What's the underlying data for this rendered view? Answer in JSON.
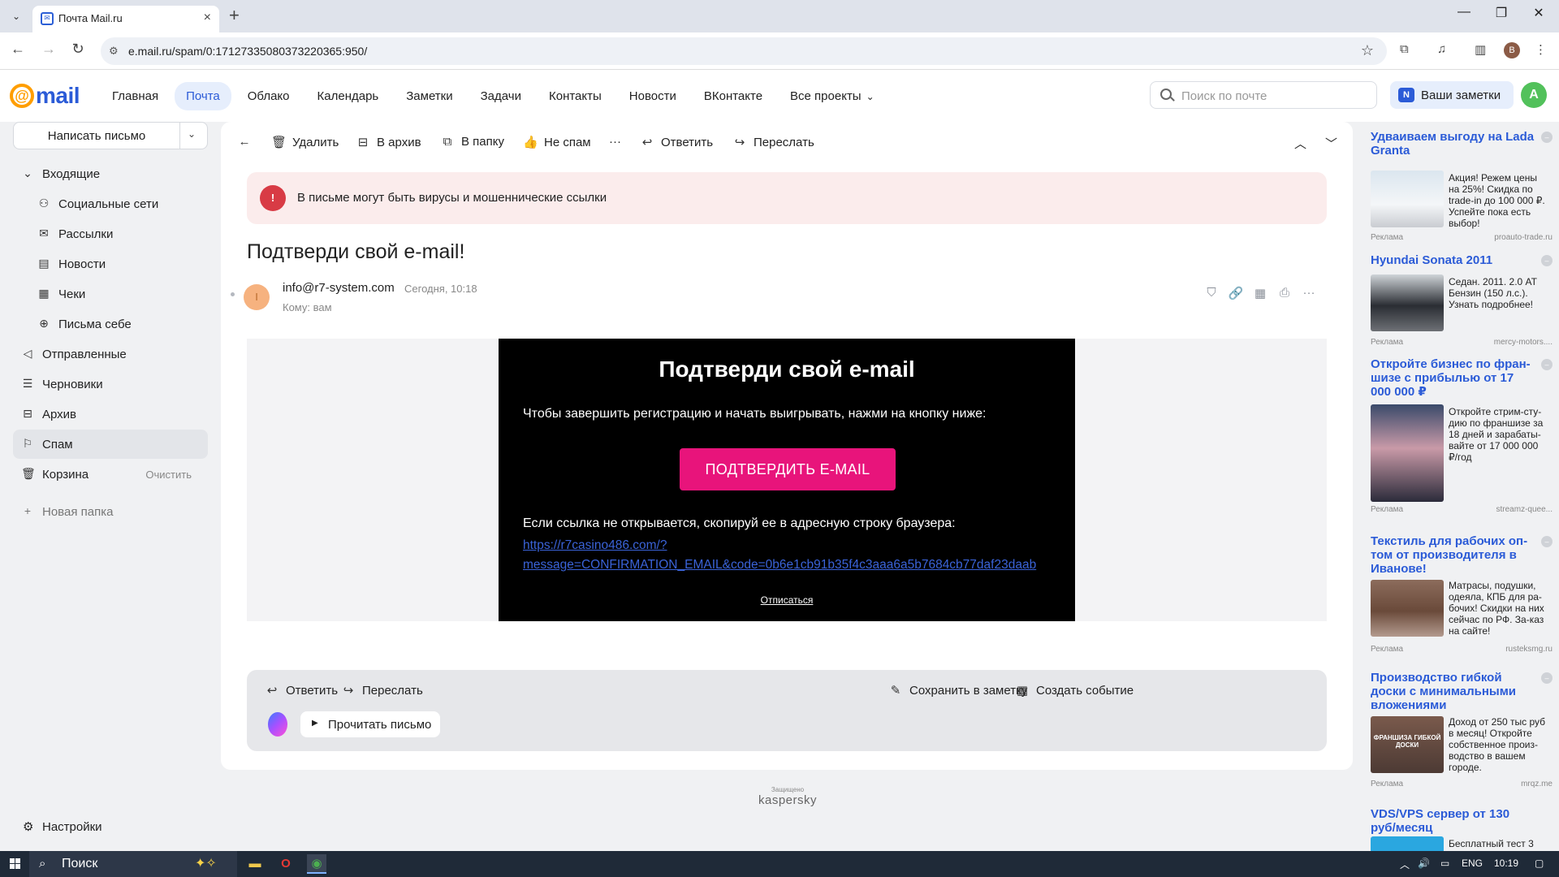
{
  "browser": {
    "tab_title": "Почта Mail.ru",
    "url": "e.mail.ru/spam/0:17127335080373220365:950/",
    "profile_initial": "B"
  },
  "header": {
    "logo_text": "mail",
    "nav": [
      "Главная",
      "Почта",
      "Облако",
      "Календарь",
      "Заметки",
      "Задачи",
      "Контакты",
      "Новости",
      "ВКонтакте",
      "Все проекты"
    ],
    "active_nav": "Почта",
    "search_placeholder": "Поиск по почте",
    "notes_label": "Ваши заметки",
    "avatar_initial": "A"
  },
  "sidebar": {
    "compose_label": "Написать письмо",
    "folders": [
      {
        "label": "Входящие",
        "icon": "chevron-down-icon"
      },
      {
        "label": "Социальные сети",
        "icon": "people-icon"
      },
      {
        "label": "Рассылки",
        "icon": "newsletter-icon"
      },
      {
        "label": "Новости",
        "icon": "news-icon"
      },
      {
        "label": "Чеки",
        "icon": "receipt-icon"
      },
      {
        "label": "Письма себе",
        "icon": "self-mail-icon"
      },
      {
        "label": "Отправленные",
        "icon": "sent-icon"
      },
      {
        "label": "Черновики",
        "icon": "draft-icon"
      },
      {
        "label": "Архив",
        "icon": "archive-icon"
      },
      {
        "label": "Спам",
        "icon": "spam-icon"
      },
      {
        "label": "Корзина",
        "icon": "trash-icon",
        "extra": "Очистить"
      }
    ],
    "new_folder": "Новая папка",
    "settings": "Настройки",
    "active_folder": "Спам"
  },
  "toolbar": {
    "delete": "Удалить",
    "archive": "В архив",
    "move": "В папку",
    "not_spam": "Не спам",
    "more": "···",
    "reply": "Ответить",
    "forward": "Переслать"
  },
  "warning": {
    "text": "В письме могут быть вирусы и мошеннические ссылки"
  },
  "message": {
    "subject": "Подтверди свой e-mail!",
    "sender_initial": "I",
    "from": "info@r7-system.com",
    "time": "Сегодня, 10:18",
    "to": "Кому: вам"
  },
  "email": {
    "title": "Подтверди свой e-mail",
    "intro": "Чтобы завершить регистрацию и начать выигрывать, нажми на кнопку ниже:",
    "button": "ПОДТВЕРДИТЬ E-MAIL",
    "copy_hint": "Если ссылка не открывается, скопируй ее в адресную строку браузера:",
    "link_line1": "https://r7casino486.com/?",
    "link_line2": "message=CONFIRMATION_EMAIL&code=0b6e1cb91b35f4c3aaa6a5b7684cb77daf23daab",
    "unsubscribe": "Отписаться",
    "accent_color": "#e8147b"
  },
  "reply_box": {
    "reply": "Ответить",
    "forward": "Переслать",
    "save_note": "Сохранить в заметку",
    "create_event": "Создать событие",
    "read_letter": "Прочитать письмо"
  },
  "footer": {
    "protected": "Защищено",
    "brand": "kaspersky"
  },
  "ads": [
    {
      "title": "Удваиваем выгоду на Lada Granta",
      "text": "Акция! Режем цены на 25%! Скидка по trade-in до 100 000 ₽. Успейте пока есть выбор!",
      "label": "Реклама",
      "domain": "proauto-trade.ru"
    },
    {
      "title": "Hyundai Sonata 2011",
      "text": "Седан. 2011. 2.0 AT Бензин (150 л.с.). Узнать подробнее!",
      "label": "Реклама",
      "domain": "mercy-motors...."
    },
    {
      "title": "Откройте бизнес по фран-шизе с прибылью от 17 000 000 ₽",
      "text": "Откройте стрим-сту-дию по франшизе за 18 дней и зарабаты-вайте от 17 000 000 ₽/год",
      "label": "Реклама",
      "domain": "streamz-quee..."
    },
    {
      "title": "Текстиль для рабочих оп-том от производителя в Иванове!",
      "text": "Матрасы, подушки, одеяла, КПБ для ра-бочих! Скидки на них сейчас по РФ. За-каз на сайте!",
      "label": "Реклама",
      "domain": "rusteksmg.ru"
    },
    {
      "title": "Производство гибкой доски с минимальными вложениями",
      "text": "Доход от 250 тыс руб в месяц! Откройте собственное произ-водство в вашем городе.",
      "label": "Реклама",
      "domain": "mrqz.me",
      "img_text": "ФРАНШИЗА ГИБКОЙ ДОСКИ"
    },
    {
      "title": "VDS/VPS сервер от 130 руб/месяц",
      "text": "Бесплатный тест 3",
      "label": "",
      "domain": ""
    }
  ],
  "taskbar": {
    "search": "Поиск",
    "lang": "ENG",
    "time": "10:19"
  }
}
